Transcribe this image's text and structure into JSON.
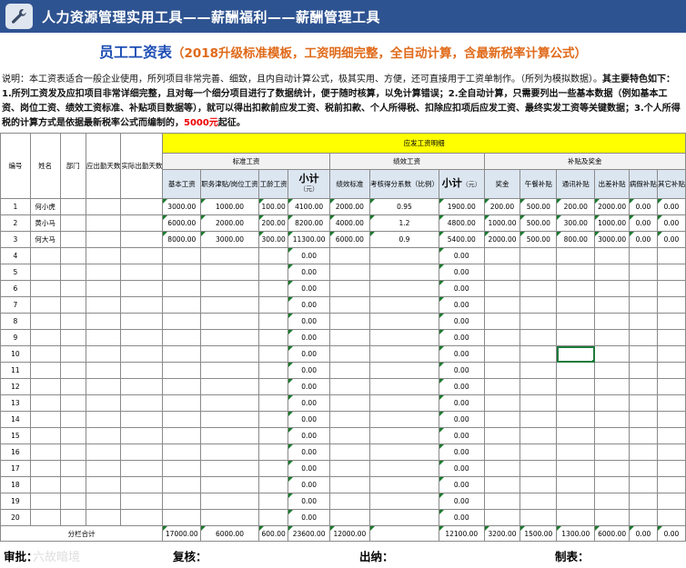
{
  "banner": {
    "title": "人力资源管理实用工具——薪酬福利——薪酬管理工具",
    "icon": "wrench-icon"
  },
  "headline": {
    "main": "员工工资表",
    "sub": "（2018升级标准模板，工资明细完整，全自动计算，含最新税率计算公式）"
  },
  "description": {
    "lead": "说明：本工资表适合一般企业使用，所列项目非常完善、细致，且内自动计算公式，极其实用、方便，还可直接用于工资单制作。（所列为模拟数据）。",
    "body": "其主要特色如下：1.所列工资发及应扣项目非常详细完整，且对每一个细分项目进行了数据统计，便于随时核算，以免计算错误；2.全自动计算，只需要列出一些基本数据（例如基本工资、岗位工资、绩效工资标准、补贴项目数据等），就可以得出扣款前应发工资、税前扣款、个人所得税、扣除应扣项后应发工资、最终实发工资等关键数据；3.个人所得税的计算方式是依据最新税率公式而编制的，",
    "highlight": "5000元",
    "tail": "起征。"
  },
  "table": {
    "headers": {
      "no": "编号",
      "name": "姓名",
      "dept": "部门",
      "due_days": "应出勤天数",
      "actual_days": "实际出勤天数",
      "payable_title": "应发工资明细",
      "std_group": "标准工资",
      "perf_group": "绩效工资",
      "allow_group": "补贴及奖金",
      "base": "基本工资",
      "post": "职务津贴/岗位工资",
      "seniority": "工龄工资",
      "subtotal": "小计",
      "unit": "（元）",
      "perf_std": "绩效标准",
      "perf_coef": "考核得分系数（比例）",
      "bonus": "奖金",
      "lunch": "午餐补贴",
      "comm": "通讯补贴",
      "travel": "出差补贴",
      "sick": "病假补贴",
      "other": "其它补贴"
    },
    "rows": [
      {
        "no": "1",
        "name": "何小虎",
        "base": "3000.00",
        "post": "1000.00",
        "seniority": "100.00",
        "std_sub": "4100.00",
        "perf_std": "2000.00",
        "coef": "0.95",
        "perf_sub": "1900.00",
        "bonus": "200.00",
        "lunch": "500.00",
        "comm": "200.00",
        "travel": "2000.00",
        "sick": "0.00",
        "other": "0.00"
      },
      {
        "no": "2",
        "name": "黄小马",
        "base": "6000.00",
        "post": "2000.00",
        "seniority": "200.00",
        "std_sub": "8200.00",
        "perf_std": "4000.00",
        "coef": "1.2",
        "perf_sub": "4800.00",
        "bonus": "1000.00",
        "lunch": "500.00",
        "comm": "300.00",
        "travel": "1000.00",
        "sick": "0.00",
        "other": "0.00"
      },
      {
        "no": "3",
        "name": "何大马",
        "base": "8000.00",
        "post": "3000.00",
        "seniority": "300.00",
        "std_sub": "11300.00",
        "perf_std": "6000.00",
        "coef": "0.9",
        "perf_sub": "5400.00",
        "bonus": "2000.00",
        "lunch": "500.00",
        "comm": "800.00",
        "travel": "3000.00",
        "sick": "0.00",
        "other": "0.00"
      },
      {
        "no": "4",
        "name": "",
        "base": "",
        "post": "",
        "seniority": "",
        "std_sub": "0.00",
        "perf_std": "",
        "coef": "",
        "perf_sub": "0.00",
        "bonus": "",
        "lunch": "",
        "comm": "",
        "travel": "",
        "sick": "",
        "other": ""
      },
      {
        "no": "5",
        "name": "",
        "base": "",
        "post": "",
        "seniority": "",
        "std_sub": "0.00",
        "perf_std": "",
        "coef": "",
        "perf_sub": "0.00",
        "bonus": "",
        "lunch": "",
        "comm": "",
        "travel": "",
        "sick": "",
        "other": ""
      },
      {
        "no": "6",
        "name": "",
        "base": "",
        "post": "",
        "seniority": "",
        "std_sub": "0.00",
        "perf_std": "",
        "coef": "",
        "perf_sub": "0.00",
        "bonus": "",
        "lunch": "",
        "comm": "",
        "travel": "",
        "sick": "",
        "other": ""
      },
      {
        "no": "7",
        "name": "",
        "base": "",
        "post": "",
        "seniority": "",
        "std_sub": "0.00",
        "perf_std": "",
        "coef": "",
        "perf_sub": "0.00",
        "bonus": "",
        "lunch": "",
        "comm": "",
        "travel": "",
        "sick": "",
        "other": ""
      },
      {
        "no": "8",
        "name": "",
        "base": "",
        "post": "",
        "seniority": "",
        "std_sub": "0.00",
        "perf_std": "",
        "coef": "",
        "perf_sub": "0.00",
        "bonus": "",
        "lunch": "",
        "comm": "",
        "travel": "",
        "sick": "",
        "other": ""
      },
      {
        "no": "9",
        "name": "",
        "base": "",
        "post": "",
        "seniority": "",
        "std_sub": "0.00",
        "perf_std": "",
        "coef": "",
        "perf_sub": "0.00",
        "bonus": "",
        "lunch": "",
        "comm": "",
        "travel": "",
        "sick": "",
        "other": ""
      },
      {
        "no": "10",
        "name": "",
        "base": "",
        "post": "",
        "seniority": "",
        "std_sub": "0.00",
        "perf_std": "",
        "coef": "",
        "perf_sub": "0.00",
        "bonus": "",
        "lunch": "",
        "comm": "",
        "travel": "",
        "sick": "",
        "other": ""
      },
      {
        "no": "11",
        "name": "",
        "base": "",
        "post": "",
        "seniority": "",
        "std_sub": "0.00",
        "perf_std": "",
        "coef": "",
        "perf_sub": "0.00",
        "bonus": "",
        "lunch": "",
        "comm": "",
        "travel": "",
        "sick": "",
        "other": ""
      },
      {
        "no": "12",
        "name": "",
        "base": "",
        "post": "",
        "seniority": "",
        "std_sub": "0.00",
        "perf_std": "",
        "coef": "",
        "perf_sub": "0.00",
        "bonus": "",
        "lunch": "",
        "comm": "",
        "travel": "",
        "sick": "",
        "other": ""
      },
      {
        "no": "13",
        "name": "",
        "base": "",
        "post": "",
        "seniority": "",
        "std_sub": "0.00",
        "perf_std": "",
        "coef": "",
        "perf_sub": "0.00",
        "bonus": "",
        "lunch": "",
        "comm": "",
        "travel": "",
        "sick": "",
        "other": ""
      },
      {
        "no": "14",
        "name": "",
        "base": "",
        "post": "",
        "seniority": "",
        "std_sub": "0.00",
        "perf_std": "",
        "coef": "",
        "perf_sub": "0.00",
        "bonus": "",
        "lunch": "",
        "comm": "",
        "travel": "",
        "sick": "",
        "other": ""
      },
      {
        "no": "15",
        "name": "",
        "base": "",
        "post": "",
        "seniority": "",
        "std_sub": "0.00",
        "perf_std": "",
        "coef": "",
        "perf_sub": "0.00",
        "bonus": "",
        "lunch": "",
        "comm": "",
        "travel": "",
        "sick": "",
        "other": ""
      },
      {
        "no": "16",
        "name": "",
        "base": "",
        "post": "",
        "seniority": "",
        "std_sub": "0.00",
        "perf_std": "",
        "coef": "",
        "perf_sub": "0.00",
        "bonus": "",
        "lunch": "",
        "comm": "",
        "travel": "",
        "sick": "",
        "other": ""
      },
      {
        "no": "17",
        "name": "",
        "base": "",
        "post": "",
        "seniority": "",
        "std_sub": "0.00",
        "perf_std": "",
        "coef": "",
        "perf_sub": "0.00",
        "bonus": "",
        "lunch": "",
        "comm": "",
        "travel": "",
        "sick": "",
        "other": ""
      },
      {
        "no": "18",
        "name": "",
        "base": "",
        "post": "",
        "seniority": "",
        "std_sub": "0.00",
        "perf_std": "",
        "coef": "",
        "perf_sub": "0.00",
        "bonus": "",
        "lunch": "",
        "comm": "",
        "travel": "",
        "sick": "",
        "other": ""
      },
      {
        "no": "19",
        "name": "",
        "base": "",
        "post": "",
        "seniority": "",
        "std_sub": "0.00",
        "perf_std": "",
        "coef": "",
        "perf_sub": "0.00",
        "bonus": "",
        "lunch": "",
        "comm": "",
        "travel": "",
        "sick": "",
        "other": ""
      },
      {
        "no": "20",
        "name": "",
        "base": "",
        "post": "",
        "seniority": "",
        "std_sub": "0.00",
        "perf_std": "",
        "coef": "",
        "perf_sub": "0.00",
        "bonus": "",
        "lunch": "",
        "comm": "",
        "travel": "",
        "sick": "",
        "other": ""
      }
    ],
    "totals": {
      "label": "分栏合计",
      "base": "17000.00",
      "post": "6000.00",
      "seniority": "600.00",
      "std_sub": "23600.00",
      "perf_std": "12000.00",
      "coef": "",
      "perf_sub": "12100.00",
      "bonus": "3200.00",
      "lunch": "1500.00",
      "comm": "1300.00",
      "travel": "6000.00",
      "sick": "0.00",
      "other": "0.00"
    }
  },
  "footer": {
    "approve": "审批：",
    "review": "复核：",
    "cashier": "出纳：",
    "prepared": "制表：",
    "watermark": "六故暗境"
  },
  "colors": {
    "banner": "#2e5391",
    "title_blue": "#1f4fb5",
    "title_orange": "#e06a1a",
    "header_yellow": "#ffff00",
    "col_header": "#dce6f1",
    "selection": "#1e7b3c",
    "highlight_red": "#e00000"
  }
}
